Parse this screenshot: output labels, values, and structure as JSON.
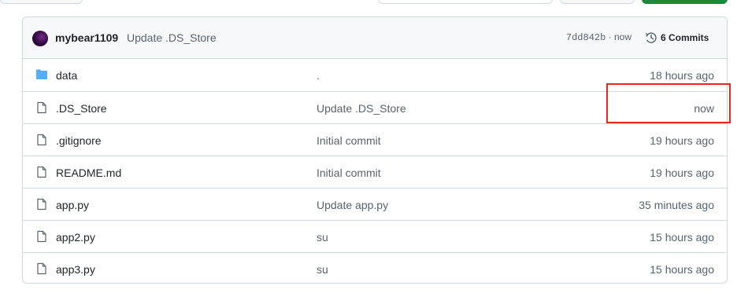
{
  "latest_commit": {
    "author": "mybear1109",
    "message": "Update .DS_Store",
    "hash": "7dd842b",
    "time": "now",
    "commits_label": "6 Commits"
  },
  "files": [
    {
      "name": "data",
      "type": "folder",
      "commit": ".",
      "time": "18 hours ago"
    },
    {
      "name": ".DS_Store",
      "type": "file",
      "commit": "Update .DS_Store",
      "time": "now"
    },
    {
      "name": ".gitignore",
      "type": "file",
      "commit": "Initial commit",
      "time": "19 hours ago"
    },
    {
      "name": "README.md",
      "type": "file",
      "commit": "Initial commit",
      "time": "19 hours ago"
    },
    {
      "name": "app.py",
      "type": "file",
      "commit": "Update app.py",
      "time": "35 minutes ago"
    },
    {
      "name": "app2.py",
      "type": "file",
      "commit": "su",
      "time": "15 hours ago"
    },
    {
      "name": "app3.py",
      "type": "file",
      "commit": "su",
      "time": "15 hours ago"
    }
  ],
  "colors": {
    "folder": "#54aeff",
    "highlight": "#e8271f",
    "code_button": "#1f883d"
  },
  "icons": {
    "folder": "folder-icon",
    "file": "file-icon",
    "history": "clock-icon"
  }
}
